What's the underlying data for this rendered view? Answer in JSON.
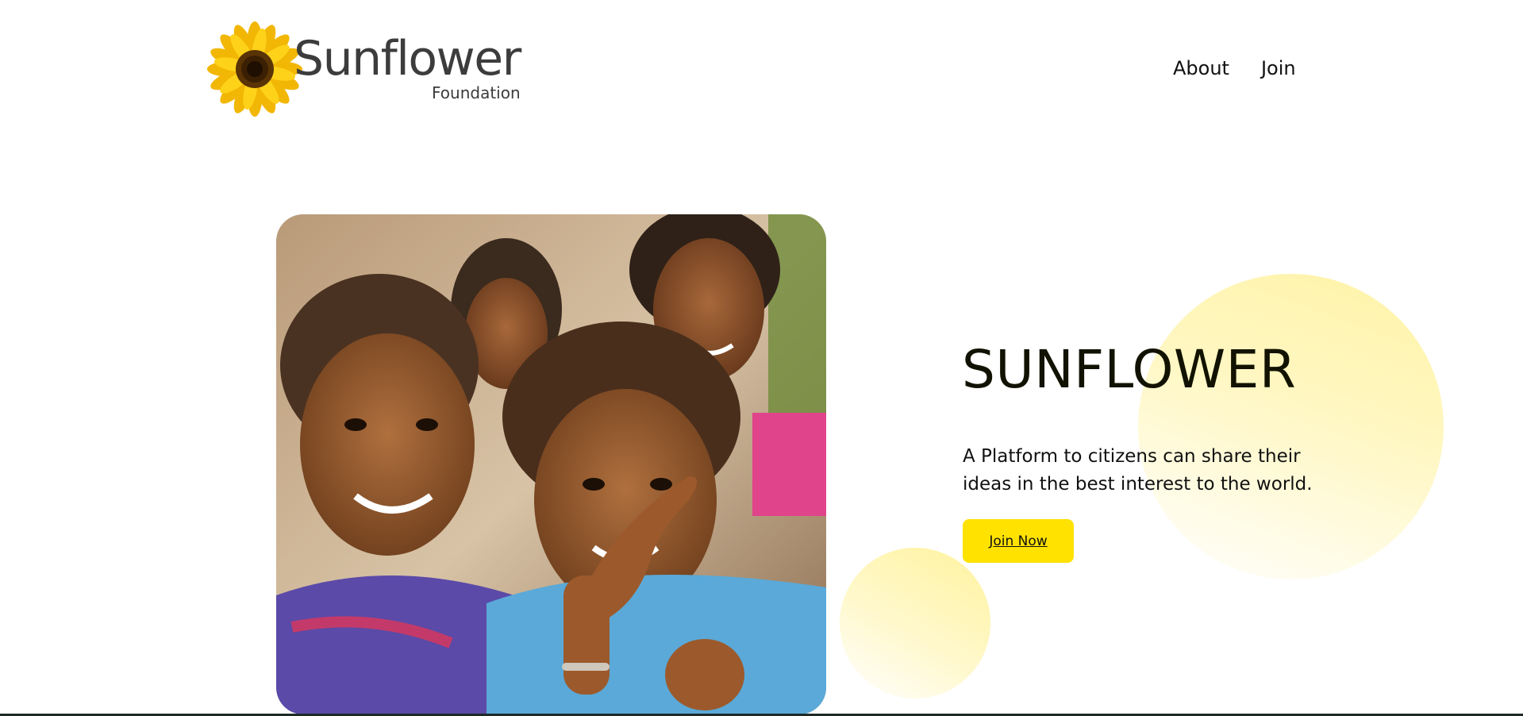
{
  "header": {
    "logo": {
      "wordmark": "Sunflower",
      "subtitle": "Foundation"
    },
    "nav": {
      "items": [
        {
          "label": "About"
        },
        {
          "label": "Join"
        }
      ]
    }
  },
  "hero": {
    "title": "SUNFLOWER",
    "description": "A Platform to citizens can share their ideas in the best interest to the world.",
    "cta_label": "Join Now",
    "photo_subject": "smiling children"
  },
  "colors": {
    "accent": "#ffe200",
    "blob": "#fff3a6",
    "text": "#111111"
  },
  "icons": {
    "logo": "sunflower-icon"
  }
}
